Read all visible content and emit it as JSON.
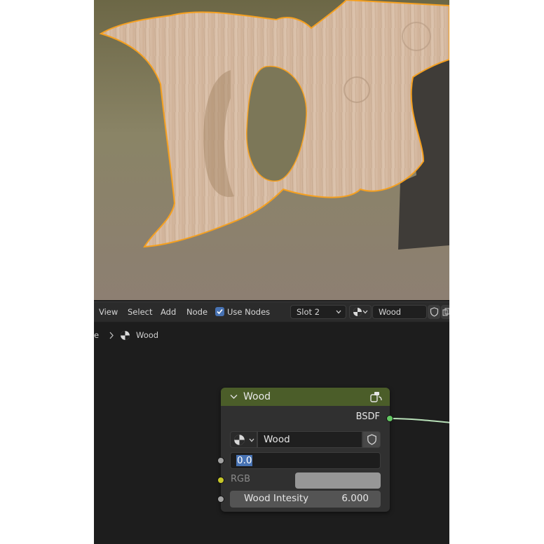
{
  "header": {
    "menu": [
      "View",
      "Select",
      "Add",
      "Node"
    ],
    "use_nodes_label": "Use Nodes",
    "use_nodes_checked": true,
    "slot_label": "Slot 2",
    "material_name": "Wood"
  },
  "breadcrumb": {
    "truncated": "e",
    "material": "Wood"
  },
  "node": {
    "title": "Wood",
    "output_label": "BSDF",
    "material_field": "Wood",
    "value_field": "0.0",
    "rgb_label": "RGB",
    "intensity_label": "Wood Intesity",
    "intensity_value": "6.000"
  },
  "colors": {
    "node_header": "#4b5d29",
    "shader_socket": "#63c763",
    "color_socket": "#c7c729",
    "value_socket": "#a1a1a1",
    "selection": "#4772b3",
    "object_outline": "#f5a020"
  }
}
